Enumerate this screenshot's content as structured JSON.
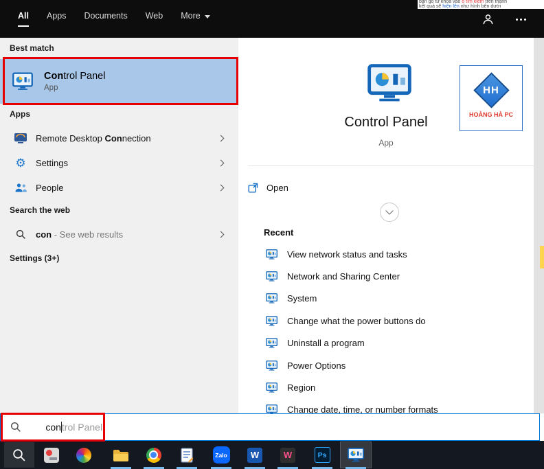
{
  "colors": {
    "accent": "#0078d7",
    "best_match_highlight": "#a9c7e8",
    "annotation_red": "#e60000",
    "logo_blue": "#1f6fd0",
    "logo_red": "#e03a2f",
    "taskbar_bg": "#141820",
    "header_bg": "#0d0d0d"
  },
  "background_page": {
    "line1_pre": "bạn gõ từ khóa vào ",
    "line1_red": "ô tìm kiếm",
    "line1_post": " trên thanh",
    "line2_pre": "kết quả sẽ ",
    "line2_blue": "hiện lên",
    "line2_post": " như hình bên dưới"
  },
  "header": {
    "tabs": [
      {
        "label": "All"
      },
      {
        "label": "Apps"
      },
      {
        "label": "Documents"
      },
      {
        "label": "Web"
      },
      {
        "label": "More"
      }
    ],
    "active_tab": "All"
  },
  "left_panel": {
    "best_match_header": "Best match",
    "best_match": {
      "title_bold": "Con",
      "title_rest": "trol Panel",
      "subtitle": "App"
    },
    "apps_header": "Apps",
    "apps": [
      {
        "prefix": "Remote Desktop ",
        "bold": "Con",
        "suffix": "nection"
      },
      {
        "prefix": "Settings",
        "bold": "",
        "suffix": ""
      },
      {
        "prefix": "People",
        "bold": "",
        "suffix": ""
      }
    ],
    "search_web_header": "Search the web",
    "web_result": {
      "bold": "con",
      "suffix": " - See web results"
    },
    "settings_header": "Settings (3+)"
  },
  "right_panel": {
    "title": "Control Panel",
    "subtitle": "App",
    "logo": {
      "monogram": "HH",
      "caption": "HOÀNG HÀ PC"
    },
    "open_label": "Open",
    "recent_header": "Recent",
    "recent": [
      "View network status and tasks",
      "Network and Sharing Center",
      "System",
      "Change what the power buttons do",
      "Uninstall a program",
      "Power Options",
      "Region",
      "Change date, time, or number formats"
    ]
  },
  "search_bar": {
    "typed": "con",
    "suggestion": "trol Panel"
  },
  "taskbar": {
    "zalo_label": "Zalo",
    "word_label": "W",
    "wamp_label": "W",
    "ps_label": "Ps"
  }
}
